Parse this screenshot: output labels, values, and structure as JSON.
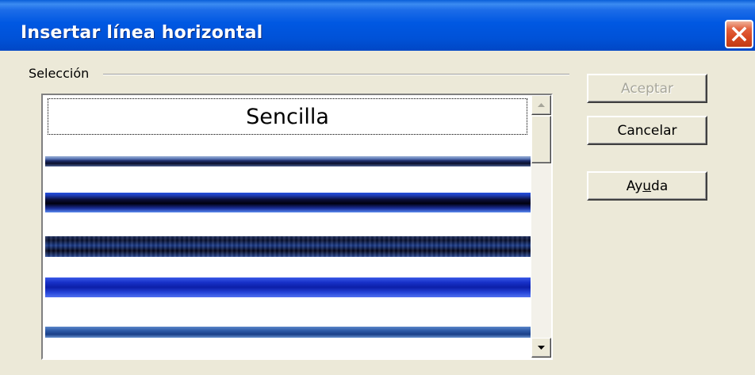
{
  "window": {
    "title": "Insertar línea horizontal"
  },
  "selection": {
    "group_label": "Selección",
    "plain_item_label": "Sencilla"
  },
  "buttons": {
    "accept": "Aceptar",
    "cancel": "Cancelar",
    "help_prefix": "Ay",
    "help_mnemonic": "u",
    "help_suffix": "da"
  },
  "colors": {
    "titlebar": "#0058e2",
    "window_bg": "#ece9d8",
    "close_button": "#d84a23",
    "disabled_text": "#a7a69a"
  }
}
